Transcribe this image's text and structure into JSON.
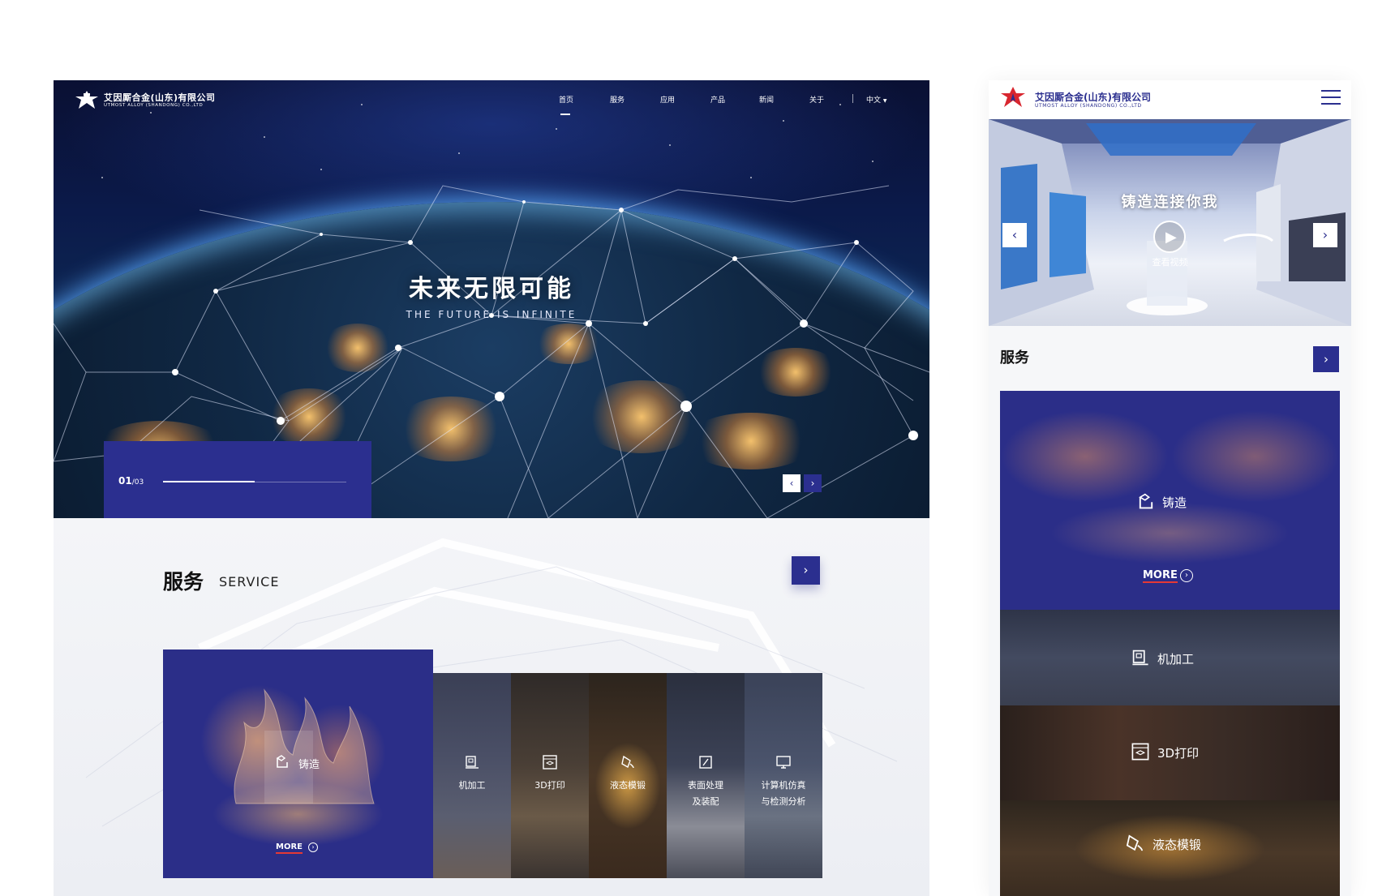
{
  "colors": {
    "brand_blue": "#2b2f8f",
    "logo_red": "#d8262f",
    "more_underline": "#e53935",
    "white": "#ffffff"
  },
  "desktop": {
    "logo": {
      "cn": "艾因厮合金(山东)有限公司",
      "en": "UTMOST ALLOY (SHANDONG) CO.,LTD",
      "icon": "eagle-logo-icon"
    },
    "nav": {
      "items": [
        "首页",
        "服务",
        "应用",
        "产品",
        "新闻",
        "关于"
      ],
      "active_index": 0,
      "language": "中文"
    },
    "hero": {
      "title": "未来无限可能",
      "subtitle": "THE FUTURE IS INFINITE",
      "counter_current": "01",
      "counter_total": "/03",
      "progress": 0.5
    },
    "service": {
      "title": "服务",
      "subtitle": "SERVICE",
      "featured": {
        "label": "铸造",
        "more": "MORE",
        "icon": "casting-icon"
      },
      "tiles": [
        {
          "label": "机加工",
          "label2": "",
          "icon": "machining-icon"
        },
        {
          "label": "3D打印",
          "label2": "",
          "icon": "3d-print-icon"
        },
        {
          "label": "液态模锻",
          "label2": "",
          "icon": "liquid-forging-icon"
        },
        {
          "label": "表面处理",
          "label2": "及装配",
          "icon": "surface-treatment-icon"
        },
        {
          "label": "计算机仿真",
          "label2": "与检测分析",
          "icon": "computer-icon"
        }
      ]
    }
  },
  "mobile": {
    "logo": {
      "cn": "艾因厮合金(山东)有限公司",
      "en": "UTMOST ALLOY (SHANDONG) CO.,LTD"
    },
    "hero": {
      "title": "铸造连接你我",
      "video_label": "查看视频"
    },
    "service": {
      "title": "服务",
      "featured": {
        "label": "铸造",
        "more": "MORE"
      },
      "items": [
        {
          "label": "机加工",
          "icon": "machining-icon"
        },
        {
          "label": "3D打印",
          "icon": "3d-print-icon"
        },
        {
          "label": "液态模锻",
          "icon": "liquid-forging-icon"
        }
      ]
    }
  }
}
